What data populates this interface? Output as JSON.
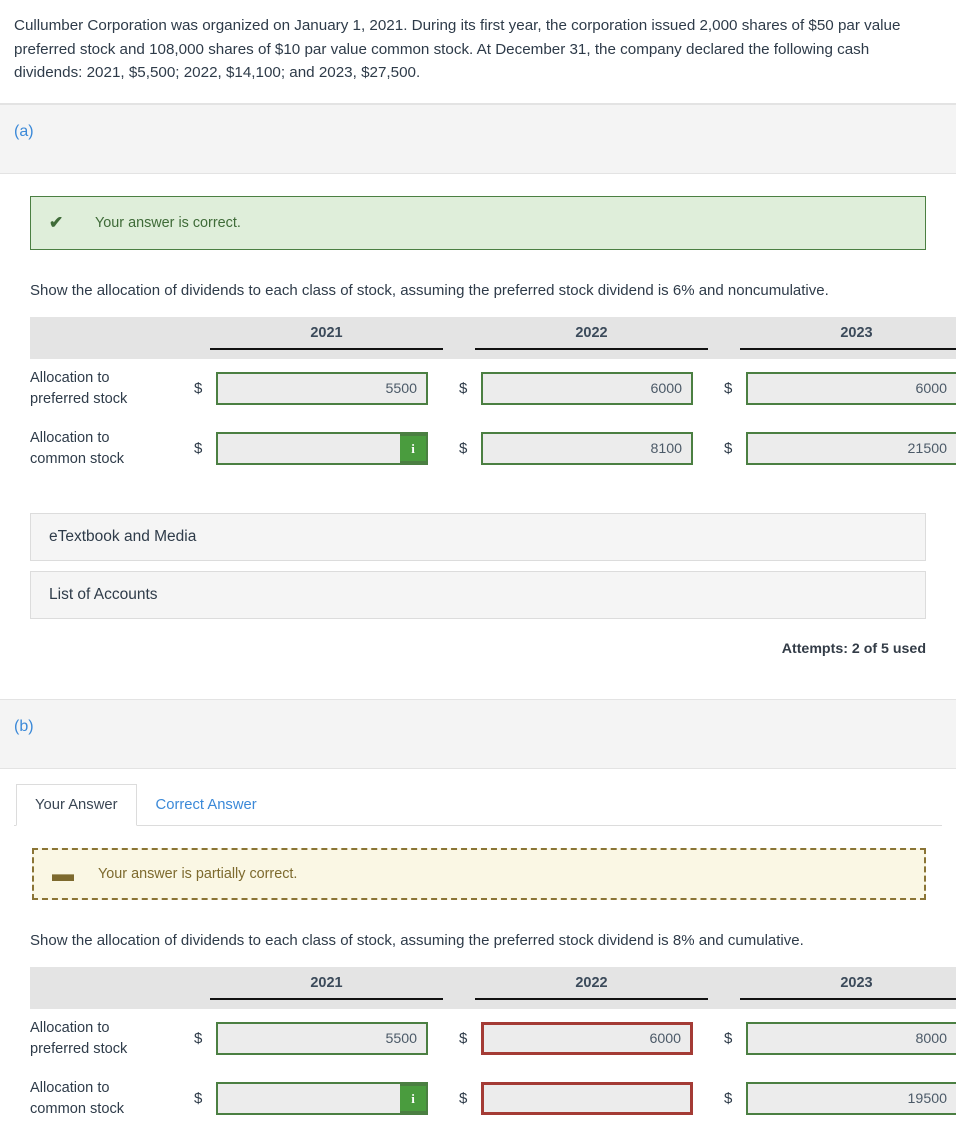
{
  "problem": {
    "statement": "Cullumber Corporation was organized on January 1, 2021. During its first year, the corporation issued 2,000 shares of $50 par value preferred stock and 108,000 shares of $10 par value common stock. At December 31, the company declared the following cash dividends: 2021, $5,500; 2022, $14,100; and 2023, $27,500."
  },
  "colors": {
    "success_border": "#4b7f42",
    "success_bg": "#dfeeda",
    "warning_border": "#8a7435",
    "warning_bg": "#faf7e4",
    "error_border": "#a43b35",
    "link": "#3b89d8",
    "badge_green": "#4a9c3e",
    "header_bg": "#e4e4e4"
  },
  "part_a": {
    "label": "(a)",
    "alert": {
      "icon": "check-icon",
      "text": "Your answer is correct."
    },
    "instruction": "Show the allocation of dividends to each class of stock, assuming the preferred stock dividend is 6% and noncumulative.",
    "table": {
      "columns": [
        "",
        "2021",
        "2022",
        "2023"
      ],
      "currency_symbol": "$",
      "rows": [
        {
          "label": "Allocation to preferred stock",
          "label_line1": "Allocation to",
          "label_line2": "preferred stock",
          "cells": [
            {
              "value": "5500",
              "state": "ok",
              "badge": ""
            },
            {
              "value": "6000",
              "state": "ok",
              "badge": ""
            },
            {
              "value": "6000",
              "state": "ok",
              "badge": ""
            }
          ]
        },
        {
          "label": "Allocation to common stock",
          "label_line1": "Allocation to",
          "label_line2": "common stock",
          "cells": [
            {
              "value": "",
              "state": "ok",
              "badge": "i"
            },
            {
              "value": "8100",
              "state": "ok",
              "badge": ""
            },
            {
              "value": "21500",
              "state": "ok",
              "badge": ""
            }
          ]
        }
      ]
    },
    "buttons": {
      "etextbook": "eTextbook and Media",
      "list_of_accounts": "List of Accounts"
    },
    "attempts": "Attempts: 2 of 5 used"
  },
  "part_b": {
    "label": "(b)",
    "tabs": [
      {
        "label": "Your Answer",
        "active": true
      },
      {
        "label": "Correct Answer",
        "active": false
      }
    ],
    "alert": {
      "icon": "dash-icon",
      "text": "Your answer is partially correct."
    },
    "instruction": "Show the allocation of dividends to each class of stock, assuming the preferred stock dividend is 8% and cumulative.",
    "table": {
      "columns": [
        "",
        "2021",
        "2022",
        "2023"
      ],
      "currency_symbol": "$",
      "rows": [
        {
          "label": "Allocation to preferred stock",
          "label_line1": "Allocation to",
          "label_line2": "preferred stock",
          "cells": [
            {
              "value": "5500",
              "state": "ok",
              "badge": ""
            },
            {
              "value": "6000",
              "state": "err",
              "badge": ""
            },
            {
              "value": "8000",
              "state": "ok",
              "badge": ""
            }
          ]
        },
        {
          "label": "Allocation to common stock",
          "label_line1": "Allocation to",
          "label_line2": "common stock",
          "cells": [
            {
              "value": "",
              "state": "ok",
              "badge": "i"
            },
            {
              "value": "",
              "state": "err",
              "badge": ""
            },
            {
              "value": "19500",
              "state": "ok",
              "badge": ""
            }
          ]
        }
      ]
    }
  }
}
